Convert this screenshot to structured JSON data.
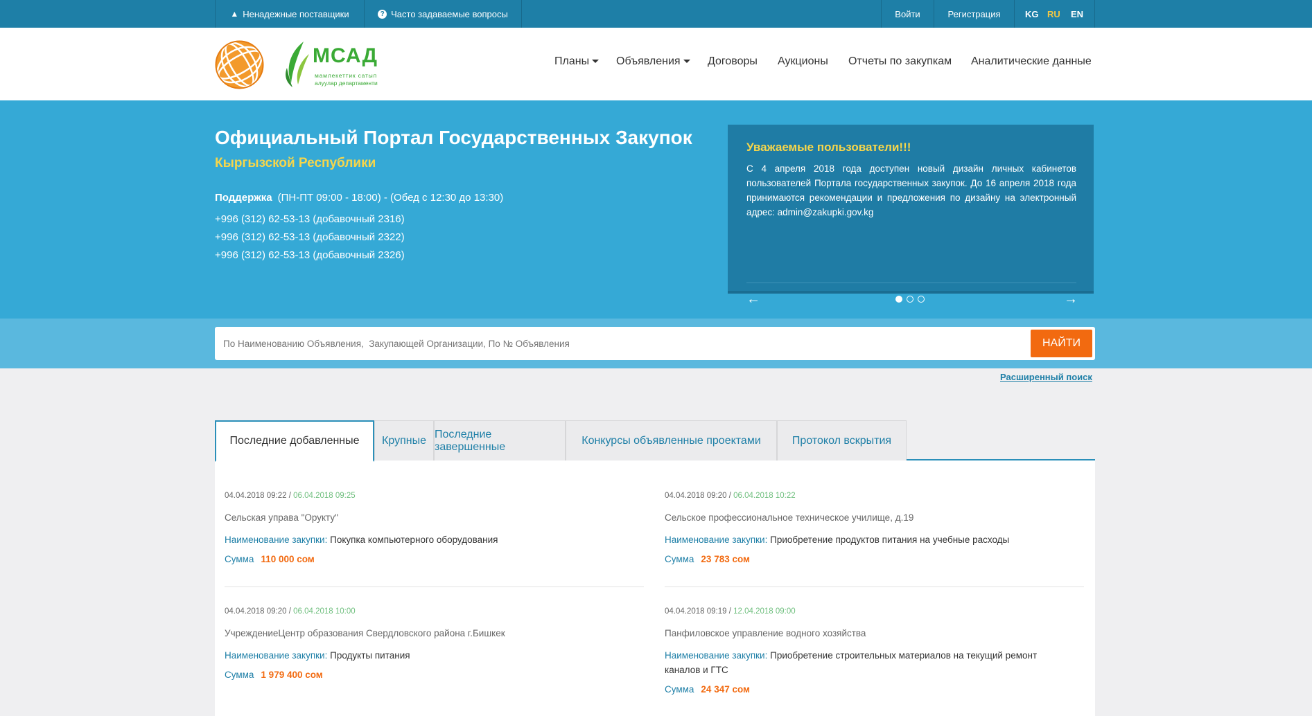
{
  "topbar": {
    "unreliable_suppliers": "Ненадежные поставщики",
    "faq": "Часто задаваемые вопросы",
    "login": "Войти",
    "register": "Регистрация",
    "languages": [
      "KG",
      "RU",
      "EN"
    ],
    "active_language": "RU"
  },
  "logo": {
    "agency_name": "МСАД",
    "agency_tagline_1": "мамлекеттик сатып",
    "agency_tagline_2": "алуулар департаменти"
  },
  "nav": {
    "plans": "Планы",
    "announcements": "Объявления",
    "contracts": "Договоры",
    "auctions": "Аукционы",
    "reports": "Отчеты по закупкам",
    "analytics": "Аналитические данные"
  },
  "hero": {
    "title": "Официальный Портал Государственных Закупок",
    "subtitle": "Кыргызской Республики",
    "support_label": "Поддержка",
    "support_hours": "(ПН-ПТ 09:00 - 18:00) - (Обед с 12:30 до 13:30)",
    "phones": [
      "+996 (312) 62-53-13 (добавочный 2316)",
      "+996 (312) 62-53-13 (добавочный 2322)",
      "+996 (312) 62-53-13 (добавочный 2326)"
    ]
  },
  "notice": {
    "title": "Уважаемые пользователи!!!",
    "text": "С 4 апреля 2018 года доступен новый дизайн личных кабинетов пользователей Портала государственных закупок. До 16 апреля 2018 года принимаются рекомендации и предложения по дизайну на электронный адрес: admin@zakupki.gov.kg",
    "prev": "←",
    "next": "→",
    "slides": 3,
    "active_slide": 1
  },
  "search": {
    "placeholder": "По Наименованию Объявления,  Закупающей Организации, По № Объявления",
    "button": "НАЙТИ",
    "advanced": "Расширенный поиск"
  },
  "tabs": [
    "Последние добавленные",
    "Крупные",
    "Последние завершенные",
    "Конкурсы объявленные проектами",
    "Протокол вскрытия"
  ],
  "listing": {
    "purchase_label": "Наименование закупки:",
    "sum_label": "Сумма",
    "items": [
      {
        "published": "04.04.2018 09:22",
        "deadline": "06.04.2018 09:25",
        "org": "Сельская управа \"Орукту\"",
        "purchase": "Покупка компьютерного оборудования",
        "sum": "110 000 сом"
      },
      {
        "published": "04.04.2018 09:20",
        "deadline": "06.04.2018 10:22",
        "org": "Сельское профессиональное техническое училище, д.19",
        "purchase": "Приобретение продуктов питания на учебные расходы",
        "sum": "23 783 сом"
      },
      {
        "published": "04.04.2018 09:20",
        "deadline": "06.04.2018 10:00",
        "org": "УчреждениеЦентр образования Свердловского района г.Бишкек",
        "purchase": "Продукты питания",
        "sum": "1 979 400 сом"
      },
      {
        "published": "04.04.2018 09:19",
        "deadline": "12.04.2018 09:00",
        "org": "Панфиловское управление водного хозяйства",
        "purchase": "Приобретение строительных материалов на текущий ремонт каналов и ГТС",
        "sum": "24 347 сом"
      }
    ]
  },
  "colors": {
    "topbar": "#1e7fa7",
    "hero": "#35a9d6",
    "accent_yellow": "#f7d64a",
    "accent_orange": "#f26a10",
    "link_blue": "#1e7fa7",
    "date_green": "#6fbf7e"
  }
}
